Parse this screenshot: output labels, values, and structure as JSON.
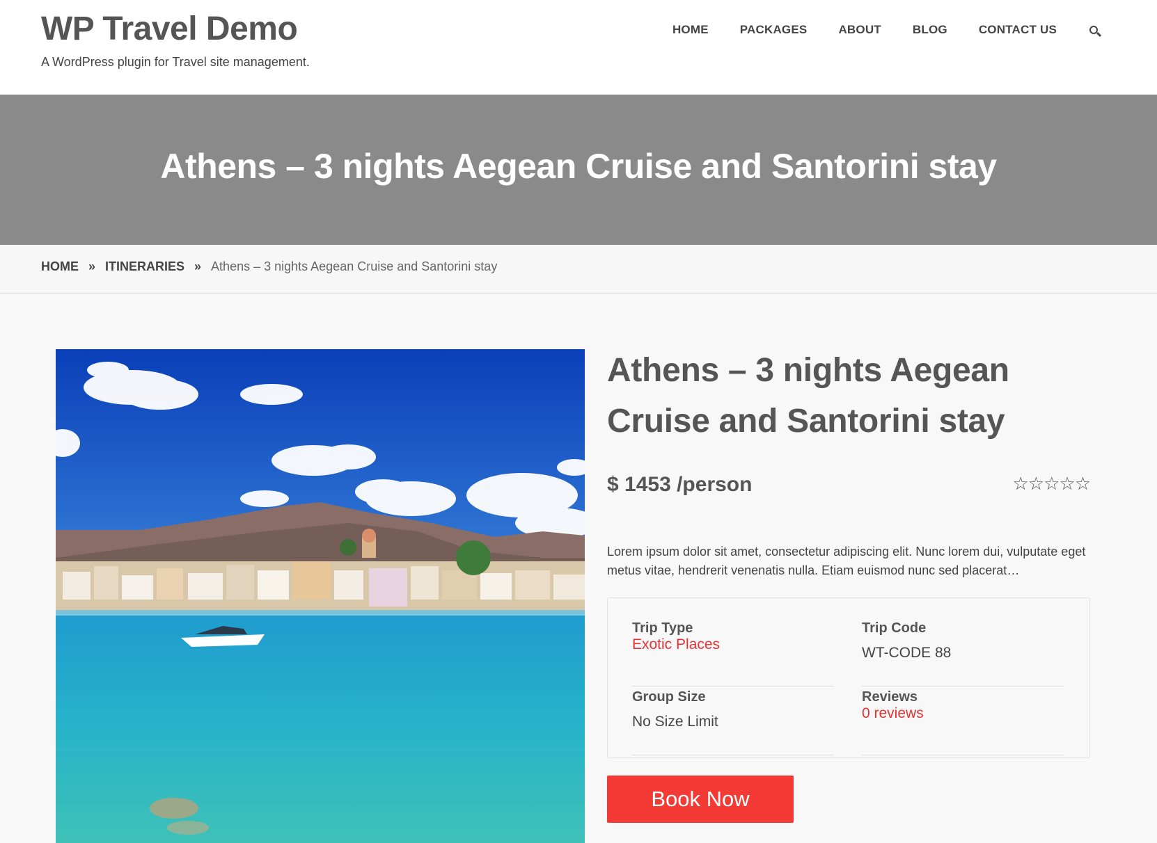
{
  "site": {
    "title": "WP Travel Demo",
    "tagline": "A WordPress plugin for Travel site management."
  },
  "nav": {
    "items": [
      "HOME",
      "PACKAGES",
      "ABOUT",
      "BLOG",
      "CONTACT US"
    ],
    "search_icon": "search-icon"
  },
  "banner": {
    "title": "Athens – 3 nights Aegean Cruise and Santorini stay"
  },
  "breadcrumb": {
    "home": "HOME",
    "section": "ITINERARIES",
    "current": "Athens – 3 nights Aegean Cruise and Santorini stay",
    "separator": "»"
  },
  "trip": {
    "title": "Athens – 3 nights Aegean Cruise and Santorini stay",
    "price": "$ 1453 /person",
    "rating": {
      "stars_filled": 0,
      "stars_total": 5,
      "display": "☆☆☆☆☆"
    },
    "excerpt": "Lorem ipsum dolor sit amet, consectetur adipiscing elit. Nunc lorem dui, vulputate eget metus vitae, hendrerit venenatis nulla. Etiam euismod nunc sed placerat…",
    "details": {
      "trip_type_label": "Trip Type",
      "trip_type_value": "Exotic Places",
      "trip_code_label": "Trip Code",
      "trip_code_value": "WT-CODE 88",
      "group_size_label": "Group Size",
      "group_size_value": "No Size Limit",
      "reviews_label": "Reviews",
      "reviews_value": "0 reviews"
    },
    "book_label": "Book Now"
  },
  "colors": {
    "accent": "#f33a35",
    "link": "#e53333",
    "banner": "#8a8a8a",
    "text": "#555555"
  }
}
